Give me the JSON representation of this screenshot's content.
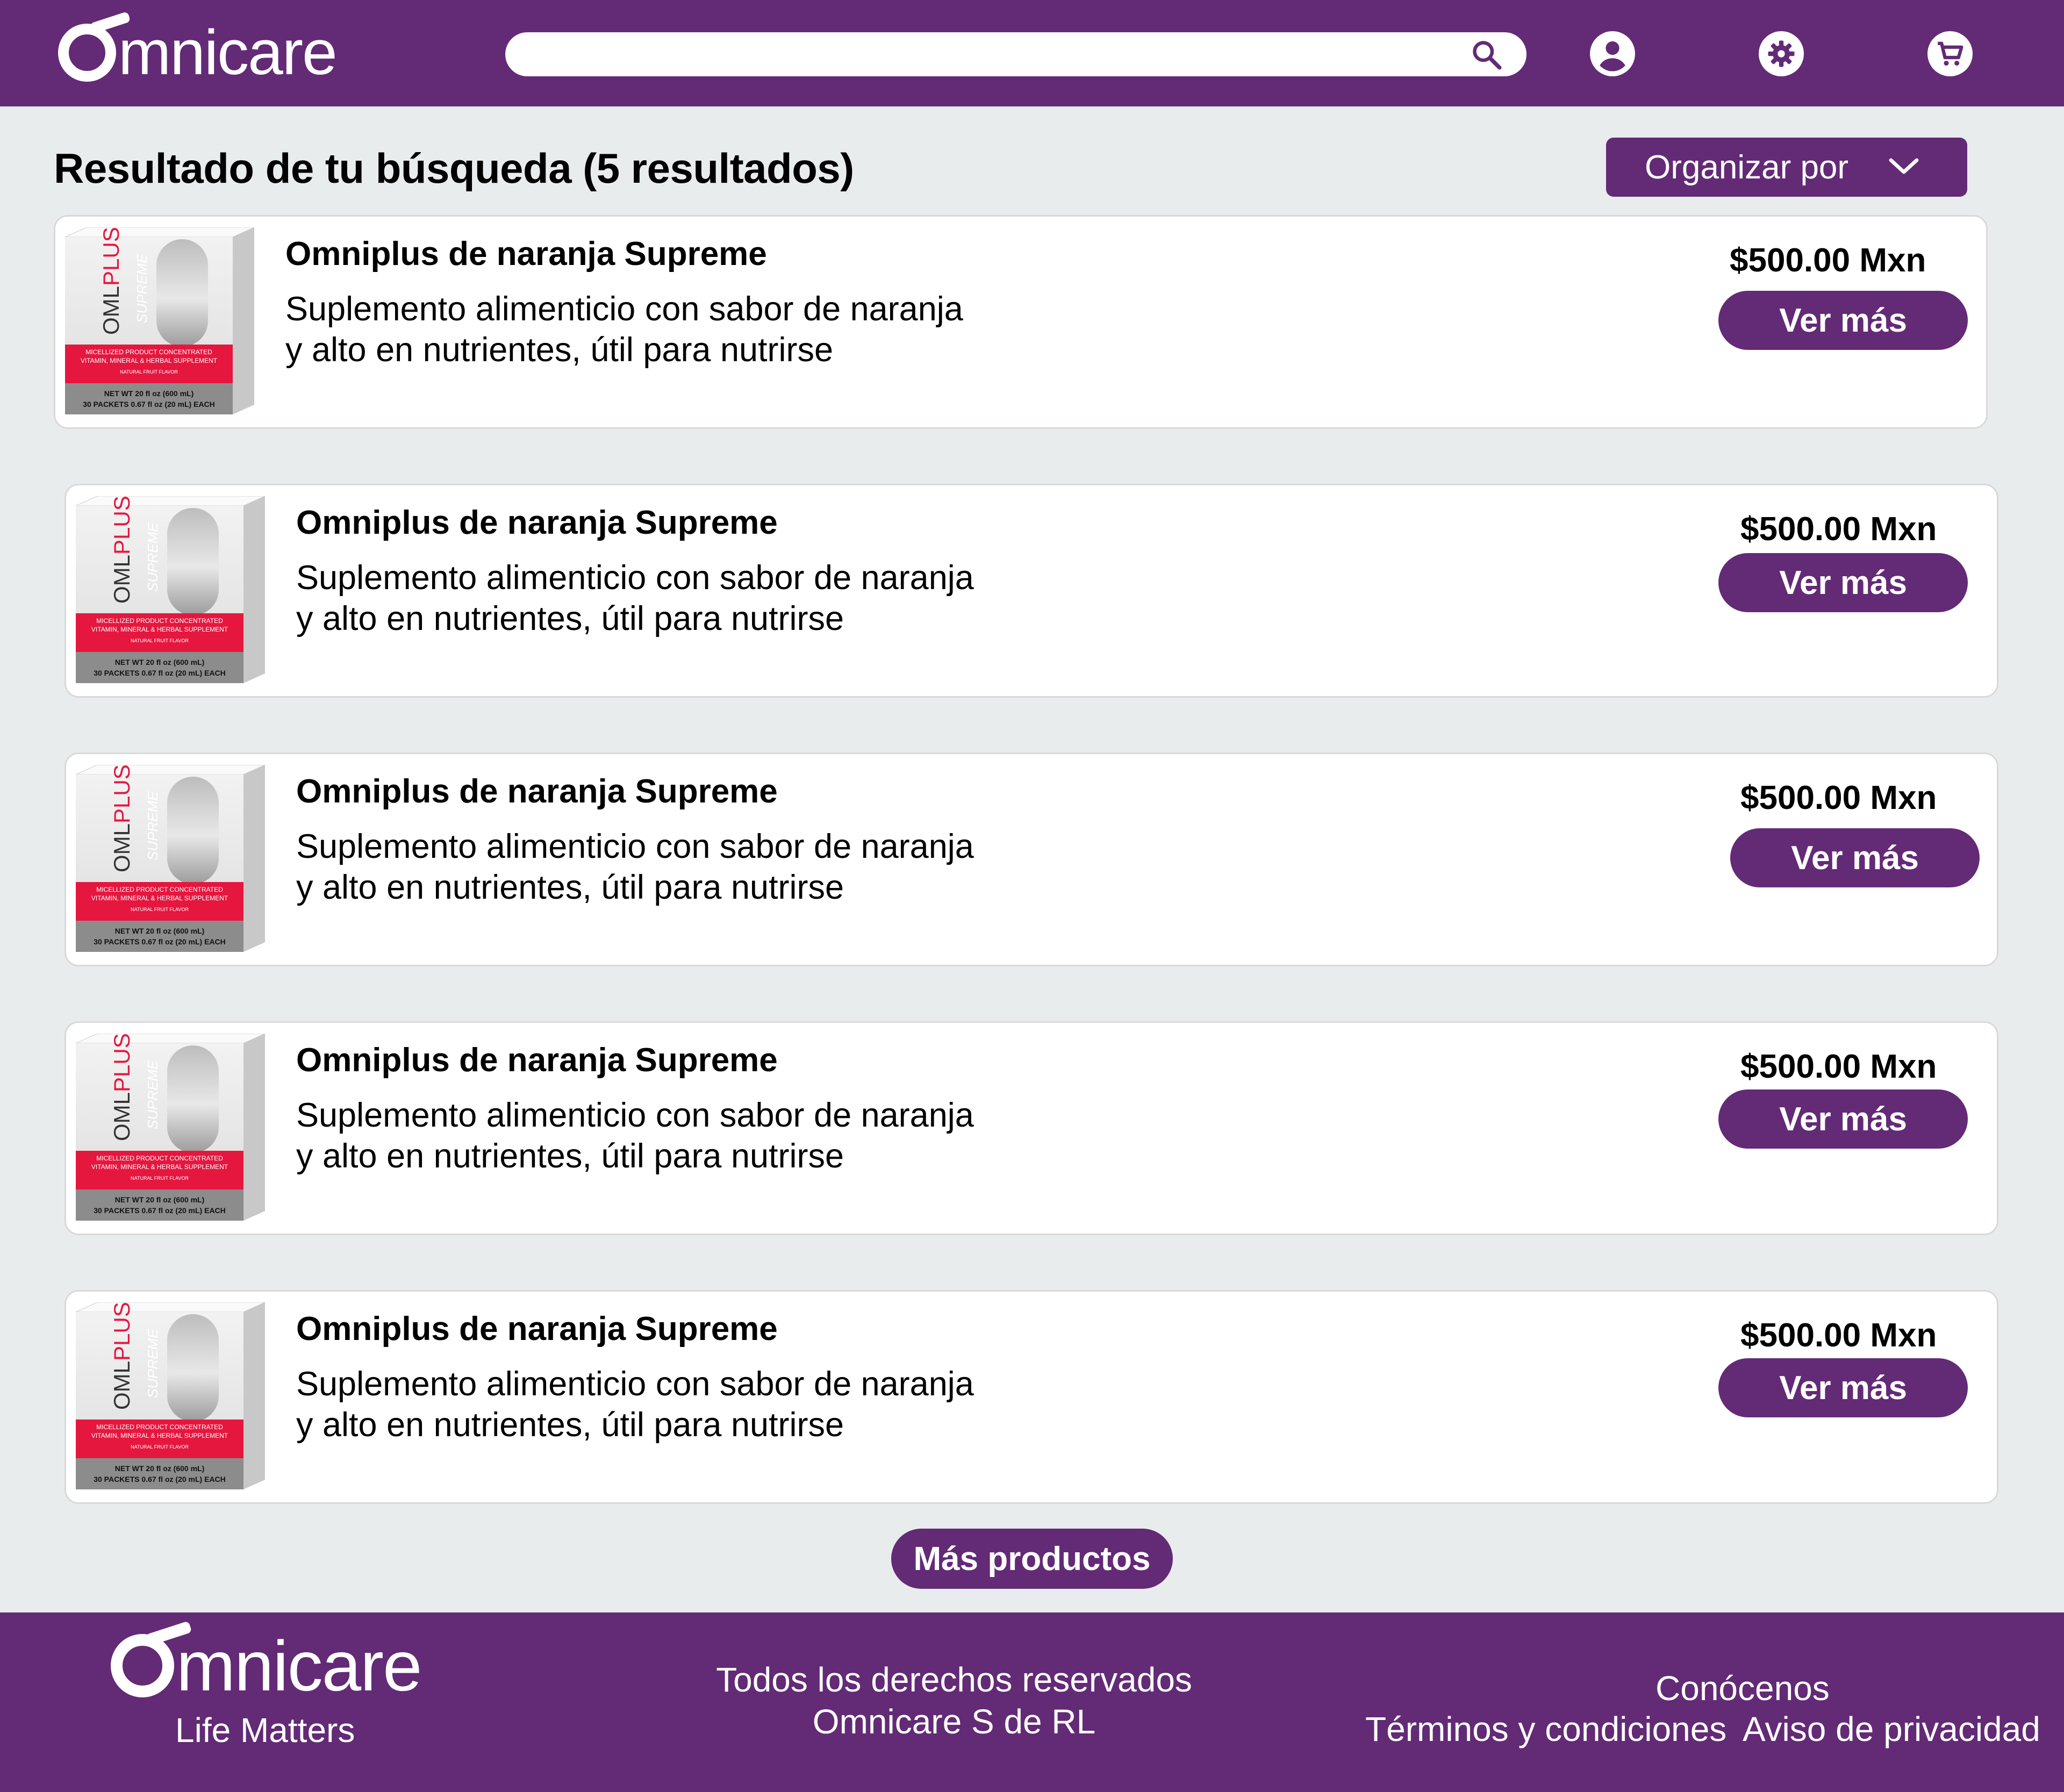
{
  "header": {
    "brand": "mnicare",
    "search_placeholder": "",
    "icons": [
      "search-icon",
      "user-icon",
      "gear-icon",
      "cart-icon"
    ]
  },
  "results": {
    "title": "Resultado de tu búsqueda (5 resultados)",
    "sort_label": "Organizar por"
  },
  "products": [
    {
      "name": "Omniplus de naranja Supreme",
      "desc1": "Suplemento alimenticio con sabor de naranja",
      "desc2": "y alto en nutrientes, útil para nutrirse",
      "price": "$500.00 Mxn",
      "button": "Ver más"
    },
    {
      "name": "Omniplus de naranja Supreme",
      "desc1": "Suplemento alimenticio con sabor de naranja",
      "desc2": "y alto en nutrientes, útil para nutrirse",
      "price": "$500.00 Mxn",
      "button": "Ver más"
    },
    {
      "name": "Omniplus de naranja Supreme",
      "desc1": "Suplemento alimenticio con sabor de naranja",
      "desc2": "y alto en nutrientes, útil para nutrirse",
      "price": "$500.00 Mxn",
      "button": "Ver más"
    },
    {
      "name": "Omniplus de naranja Supreme",
      "desc1": "Suplemento alimenticio con sabor de naranja",
      "desc2": "y alto en nutrientes, útil para nutrirse",
      "price": "$500.00 Mxn",
      "button": "Ver más"
    },
    {
      "name": "Omniplus de naranja Supreme",
      "desc1": "Suplemento alimenticio con sabor de naranja",
      "desc2": "y alto en nutrientes, útil para nutrirse",
      "price": "$500.00 Mxn",
      "button": "Ver más"
    }
  ],
  "product_box": {
    "brand_oml": "OML",
    "brand_plus": "PLUS",
    "supreme": "SUPREME",
    "band_line1": "MICELLIZED PRODUCT CONCENTRATED",
    "band_line2": "VITAMIN, MINERAL & HERBAL SUPPLEMENT",
    "band_line3": "NATURAL FRUIT FLAVOR",
    "net_line1": "NET WT 20 fl oz (600 mL)",
    "net_line2": "30 PACKETS 0.67 fl oz (20 mL) EACH"
  },
  "more_button": "Más productos",
  "footer": {
    "brand": "mnicare",
    "tagline": "Life Matters",
    "rights_line1": "Todos los derechos reservados",
    "rights_line2": "Omnicare S de RL",
    "conocenos": "Conócenos",
    "terminos": "Términos y condiciones",
    "privacidad": "Aviso de privacidad"
  },
  "colors": {
    "brand_purple": "#632a76",
    "background": "#e9ecec",
    "card": "#ffffff",
    "box_red": "#e5173f"
  }
}
